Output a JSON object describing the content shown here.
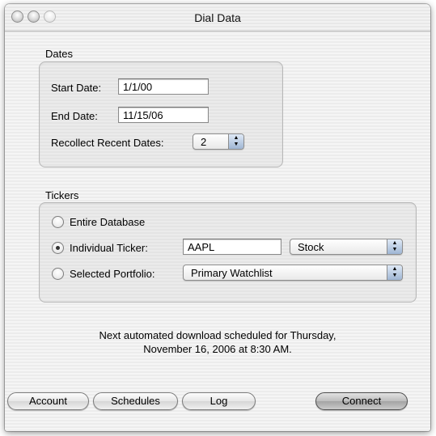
{
  "window": {
    "title": "Dial Data"
  },
  "dates": {
    "section_label": "Dates",
    "start_date_label": "Start Date:",
    "start_date_value": "1/1/00",
    "end_date_label": "End Date:",
    "end_date_value": "11/15/06",
    "recollect_label": "Recollect Recent Dates:",
    "recollect_value": "2"
  },
  "tickers": {
    "section_label": "Tickers",
    "options": [
      {
        "label": "Entire Database",
        "selected": false
      },
      {
        "label": "Individual Ticker:",
        "selected": true
      },
      {
        "label": "Selected Portfolio:",
        "selected": false
      }
    ],
    "ticker_value": "AAPL",
    "ticker_type": "Stock",
    "portfolio_value": "Primary Watchlist"
  },
  "message": {
    "line1": "Next automated download scheduled for Thursday,",
    "line2": "November 16, 2006 at 8:30 AM."
  },
  "buttons": {
    "account": "Account",
    "schedules": "Schedules",
    "log": "Log",
    "connect": "Connect"
  }
}
